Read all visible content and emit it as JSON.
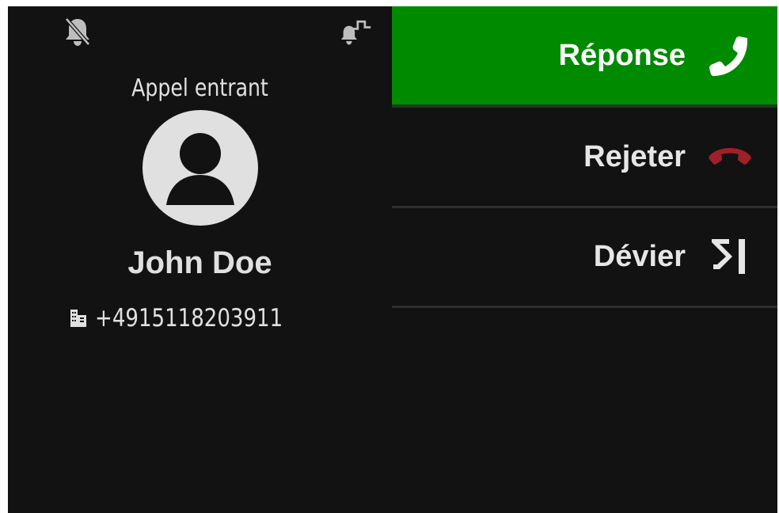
{
  "status_bar": {
    "icons": [
      "bell-off-icon",
      "bell-signal-icon"
    ]
  },
  "call": {
    "status": "Appel entrant",
    "caller_name": "John Doe",
    "caller_number": "+4915118203911",
    "number_type_icon": "building-icon"
  },
  "actions": [
    {
      "label": "Réponse",
      "icon": "phone-answer-icon",
      "color": "#008a00"
    },
    {
      "label": "Rejeter",
      "icon": "phone-hangup-icon",
      "color": "#a0202a"
    },
    {
      "label": "Dévier",
      "icon": "deflect-icon",
      "color": "#e6e6e6"
    }
  ],
  "colors": {
    "background": "#121212",
    "answer_green": "#008a00",
    "text": "#e0e0e0",
    "hangup_red": "#a0202a"
  }
}
